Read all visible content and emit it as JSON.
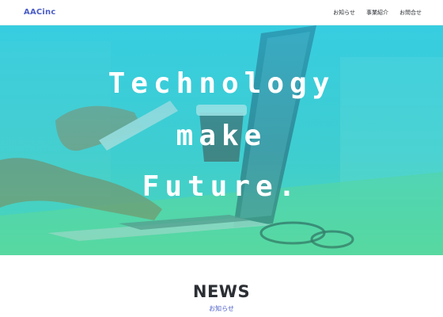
{
  "header": {
    "brand": "AACinc",
    "nav": [
      {
        "label": "お知らせ"
      },
      {
        "label": "事業紹介"
      },
      {
        "label": "お問合せ"
      }
    ]
  },
  "hero": {
    "lines": [
      "Technology",
      "make",
      "Future."
    ]
  },
  "news": {
    "title": "NEWS",
    "subtitle": "お知らせ"
  },
  "colors": {
    "brand": "#4b5dc7",
    "hero_top": "#3fd8e4",
    "hero_bottom": "#5fd78f",
    "text_dark": "#2b2f34"
  }
}
